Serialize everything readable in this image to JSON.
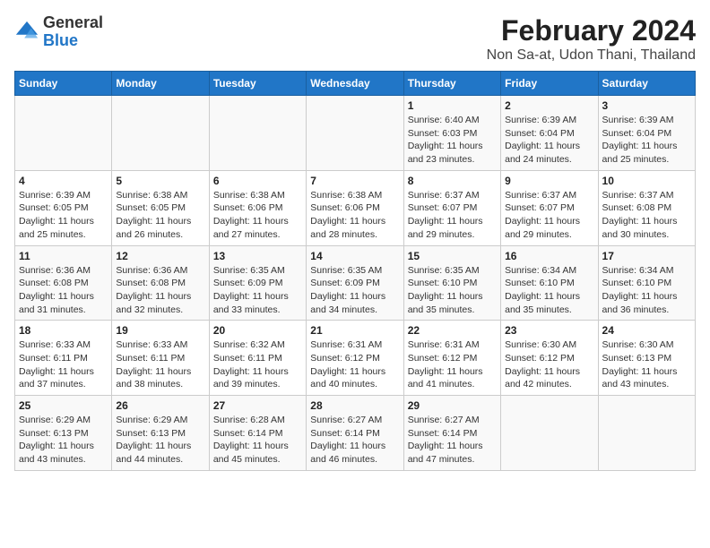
{
  "header": {
    "logo_general": "General",
    "logo_blue": "Blue",
    "title": "February 2024",
    "subtitle": "Non Sa-at, Udon Thani, Thailand"
  },
  "weekdays": [
    "Sunday",
    "Monday",
    "Tuesday",
    "Wednesday",
    "Thursday",
    "Friday",
    "Saturday"
  ],
  "weeks": [
    [
      {
        "day": "",
        "info": ""
      },
      {
        "day": "",
        "info": ""
      },
      {
        "day": "",
        "info": ""
      },
      {
        "day": "",
        "info": ""
      },
      {
        "day": "1",
        "info": "Sunrise: 6:40 AM\nSunset: 6:03 PM\nDaylight: 11 hours and 23 minutes."
      },
      {
        "day": "2",
        "info": "Sunrise: 6:39 AM\nSunset: 6:04 PM\nDaylight: 11 hours and 24 minutes."
      },
      {
        "day": "3",
        "info": "Sunrise: 6:39 AM\nSunset: 6:04 PM\nDaylight: 11 hours and 25 minutes."
      }
    ],
    [
      {
        "day": "4",
        "info": "Sunrise: 6:39 AM\nSunset: 6:05 PM\nDaylight: 11 hours and 25 minutes."
      },
      {
        "day": "5",
        "info": "Sunrise: 6:38 AM\nSunset: 6:05 PM\nDaylight: 11 hours and 26 minutes."
      },
      {
        "day": "6",
        "info": "Sunrise: 6:38 AM\nSunset: 6:06 PM\nDaylight: 11 hours and 27 minutes."
      },
      {
        "day": "7",
        "info": "Sunrise: 6:38 AM\nSunset: 6:06 PM\nDaylight: 11 hours and 28 minutes."
      },
      {
        "day": "8",
        "info": "Sunrise: 6:37 AM\nSunset: 6:07 PM\nDaylight: 11 hours and 29 minutes."
      },
      {
        "day": "9",
        "info": "Sunrise: 6:37 AM\nSunset: 6:07 PM\nDaylight: 11 hours and 29 minutes."
      },
      {
        "day": "10",
        "info": "Sunrise: 6:37 AM\nSunset: 6:08 PM\nDaylight: 11 hours and 30 minutes."
      }
    ],
    [
      {
        "day": "11",
        "info": "Sunrise: 6:36 AM\nSunset: 6:08 PM\nDaylight: 11 hours and 31 minutes."
      },
      {
        "day": "12",
        "info": "Sunrise: 6:36 AM\nSunset: 6:08 PM\nDaylight: 11 hours and 32 minutes."
      },
      {
        "day": "13",
        "info": "Sunrise: 6:35 AM\nSunset: 6:09 PM\nDaylight: 11 hours and 33 minutes."
      },
      {
        "day": "14",
        "info": "Sunrise: 6:35 AM\nSunset: 6:09 PM\nDaylight: 11 hours and 34 minutes."
      },
      {
        "day": "15",
        "info": "Sunrise: 6:35 AM\nSunset: 6:10 PM\nDaylight: 11 hours and 35 minutes."
      },
      {
        "day": "16",
        "info": "Sunrise: 6:34 AM\nSunset: 6:10 PM\nDaylight: 11 hours and 35 minutes."
      },
      {
        "day": "17",
        "info": "Sunrise: 6:34 AM\nSunset: 6:10 PM\nDaylight: 11 hours and 36 minutes."
      }
    ],
    [
      {
        "day": "18",
        "info": "Sunrise: 6:33 AM\nSunset: 6:11 PM\nDaylight: 11 hours and 37 minutes."
      },
      {
        "day": "19",
        "info": "Sunrise: 6:33 AM\nSunset: 6:11 PM\nDaylight: 11 hours and 38 minutes."
      },
      {
        "day": "20",
        "info": "Sunrise: 6:32 AM\nSunset: 6:11 PM\nDaylight: 11 hours and 39 minutes."
      },
      {
        "day": "21",
        "info": "Sunrise: 6:31 AM\nSunset: 6:12 PM\nDaylight: 11 hours and 40 minutes."
      },
      {
        "day": "22",
        "info": "Sunrise: 6:31 AM\nSunset: 6:12 PM\nDaylight: 11 hours and 41 minutes."
      },
      {
        "day": "23",
        "info": "Sunrise: 6:30 AM\nSunset: 6:12 PM\nDaylight: 11 hours and 42 minutes."
      },
      {
        "day": "24",
        "info": "Sunrise: 6:30 AM\nSunset: 6:13 PM\nDaylight: 11 hours and 43 minutes."
      }
    ],
    [
      {
        "day": "25",
        "info": "Sunrise: 6:29 AM\nSunset: 6:13 PM\nDaylight: 11 hours and 43 minutes."
      },
      {
        "day": "26",
        "info": "Sunrise: 6:29 AM\nSunset: 6:13 PM\nDaylight: 11 hours and 44 minutes."
      },
      {
        "day": "27",
        "info": "Sunrise: 6:28 AM\nSunset: 6:14 PM\nDaylight: 11 hours and 45 minutes."
      },
      {
        "day": "28",
        "info": "Sunrise: 6:27 AM\nSunset: 6:14 PM\nDaylight: 11 hours and 46 minutes."
      },
      {
        "day": "29",
        "info": "Sunrise: 6:27 AM\nSunset: 6:14 PM\nDaylight: 11 hours and 47 minutes."
      },
      {
        "day": "",
        "info": ""
      },
      {
        "day": "",
        "info": ""
      }
    ]
  ]
}
